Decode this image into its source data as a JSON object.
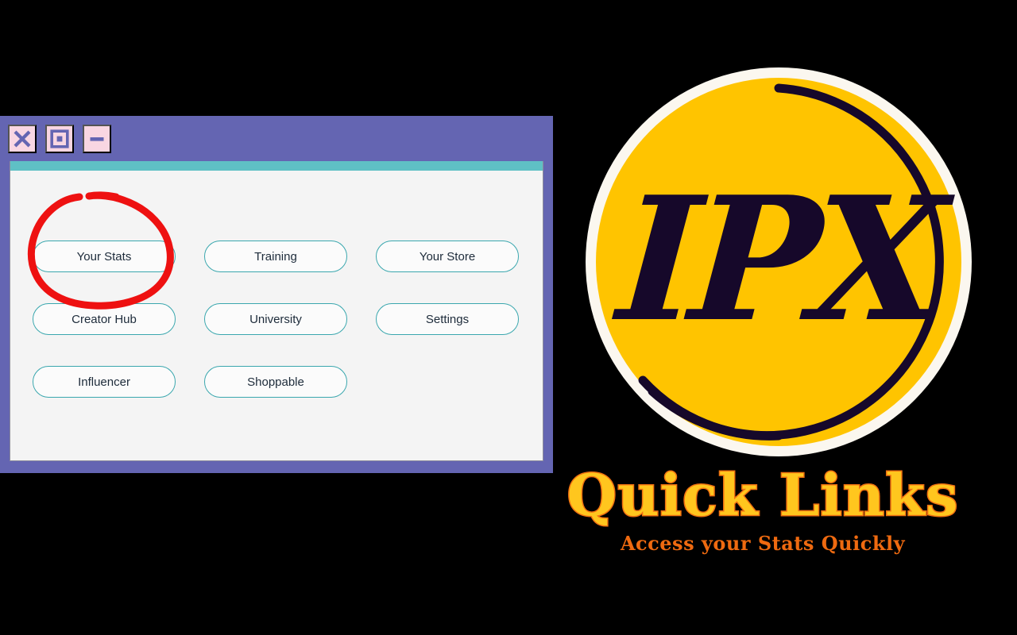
{
  "background_color": "#000000",
  "window": {
    "frame_color": "#6465b2",
    "panel_color": "#f4f4f4",
    "accent_bar_color": "#5fc0c5",
    "controls": [
      {
        "name": "close",
        "icon": "close-x-icon",
        "label": "Close"
      },
      {
        "name": "maximize",
        "icon": "maximize-square-icon",
        "label": "Maximize"
      },
      {
        "name": "minimize",
        "icon": "minimize-dash-icon",
        "label": "Minimize"
      }
    ],
    "button_border_color": "#3aa7ae",
    "button_text_color": "#1d2b3a",
    "buttons": [
      {
        "label": "Your Stats",
        "highlighted": true
      },
      {
        "label": "Training",
        "highlighted": false
      },
      {
        "label": "Your Store",
        "highlighted": false
      },
      {
        "label": "Creator Hub",
        "highlighted": false
      },
      {
        "label": "University",
        "highlighted": false
      },
      {
        "label": "Settings",
        "highlighted": false
      },
      {
        "label": "Influencer",
        "highlighted": false
      },
      {
        "label": "Shoppable",
        "highlighted": false
      }
    ]
  },
  "annotation": {
    "type": "hand-drawn-circle",
    "color": "#ee1111",
    "targets": "Your Stats"
  },
  "logo": {
    "text": "IPX",
    "disc_color": "#ffc400",
    "ring_color": "#fbf7ef",
    "inner_ring_color": "#16082a",
    "text_color": "#16082a"
  },
  "headline": {
    "title": "Quick Links",
    "title_fill": "#ffc61e",
    "title_stroke": "#f07010",
    "subtitle": "Access your Stats Quickly",
    "subtitle_color": "#ef6a10"
  }
}
